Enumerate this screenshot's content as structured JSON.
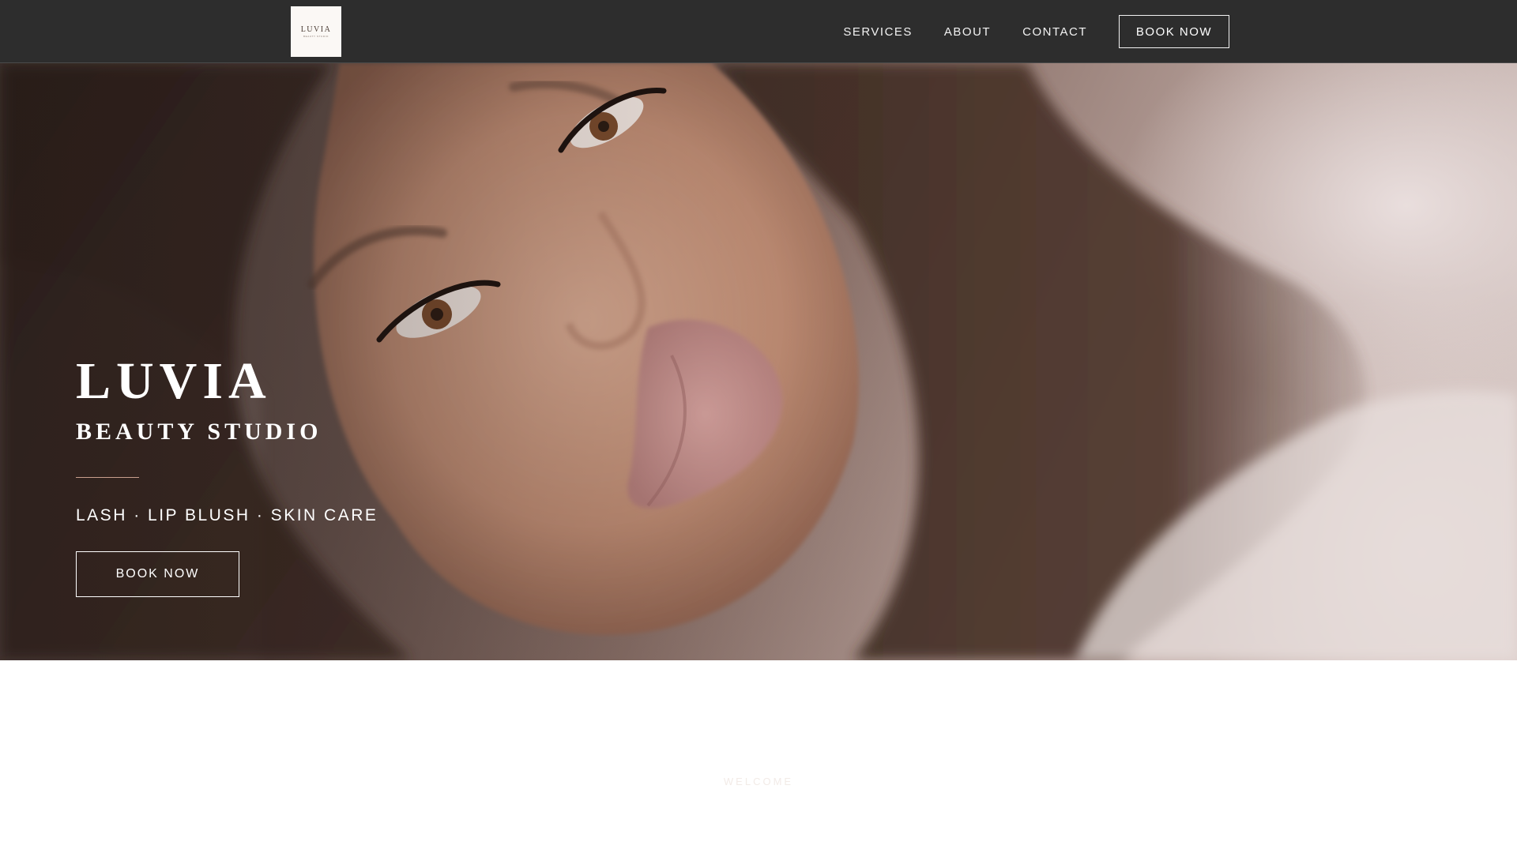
{
  "nav": {
    "logo": {
      "word": "LUVIA",
      "sub": "BEAUTY STUDIO"
    },
    "links": [
      {
        "label": "SERVICES"
      },
      {
        "label": "ABOUT"
      },
      {
        "label": "CONTACT"
      }
    ],
    "book_label": "BOOK NOW"
  },
  "hero": {
    "title": "LUVIA",
    "subtitle": "BEAUTY STUDIO",
    "services": "LASH · LIP BLUSH · SKIN CARE",
    "book_label": "BOOK NOW",
    "accent_color": "#c99f8e"
  },
  "intro": {
    "eyebrow": "WELCOME"
  },
  "colors": {
    "nav_bg": "#2d2d2d",
    "page_bg": "#ffffff",
    "text_light": "#ffffff"
  }
}
